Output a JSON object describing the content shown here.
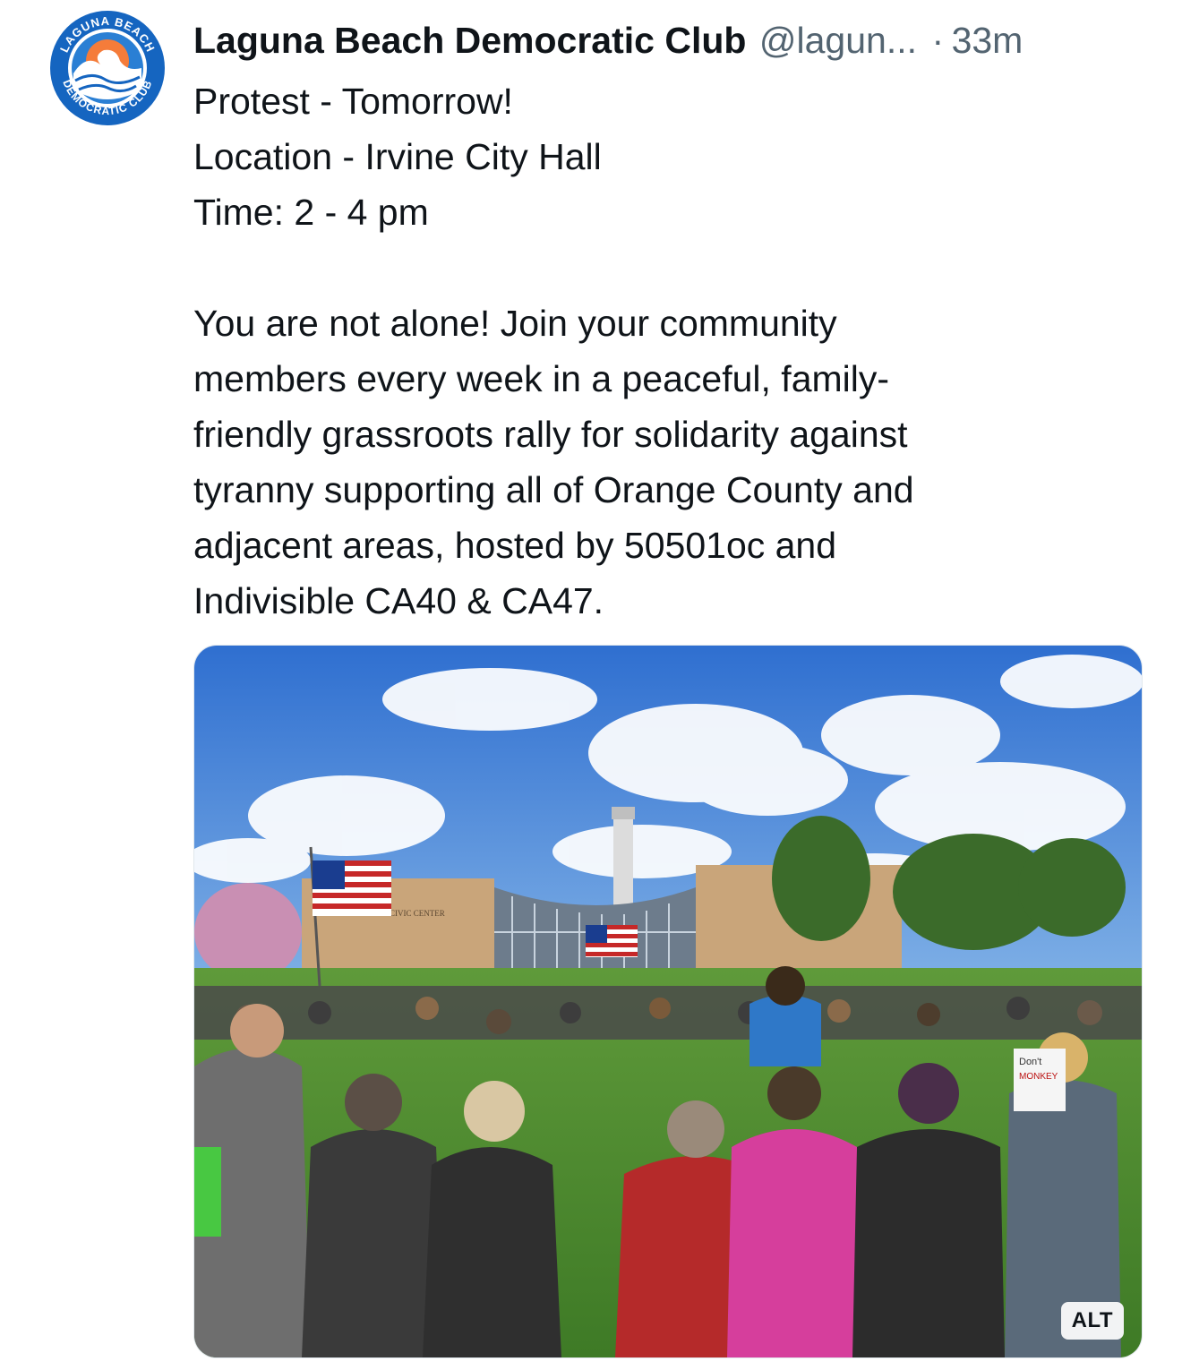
{
  "post": {
    "author_name": "Laguna Beach Democratic Club",
    "author_handle": "@lagun...",
    "separator": "·",
    "time": "33m",
    "avatar": {
      "icon": "laguna-beach-democratic-club-logo-icon",
      "ring_text_top": "LAGUNA BEACH",
      "ring_text_bottom": "DEMOCRATIC CLUB",
      "colors": {
        "ring": "#1565c0",
        "sun": "#f57c3a",
        "wave": "#ffffff"
      }
    },
    "lines": [
      "Protest - Tomorrow!",
      "Location - Irvine City Hall",
      "Time: 2 - 4 pm",
      "",
      "You are not alone! Join your community",
      "members every week in a peaceful, family-",
      "friendly grassroots rally for solidarity against",
      "tyranny supporting all of Orange County and",
      "adjacent areas, hosted by 50501oc and",
      "Indivisible CA40 & CA47."
    ],
    "media": {
      "description_icon": "protest-crowd-photo",
      "sign_text": [
        "CIVIC CENTER",
        "Don't",
        "MONKEY"
      ],
      "alt_label": "ALT"
    }
  }
}
